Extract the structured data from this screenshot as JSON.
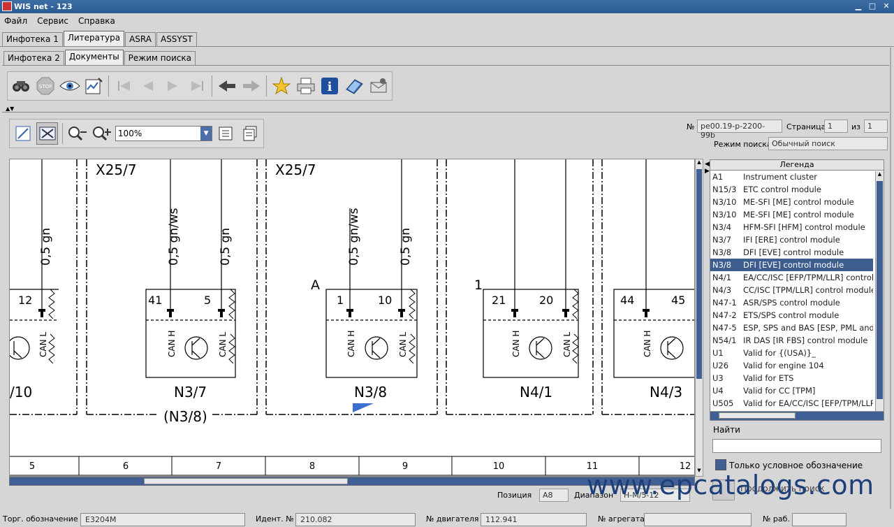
{
  "window": {
    "title": "WIS net - 123",
    "controls": [
      "▁",
      "□",
      "✕"
    ]
  },
  "menu": [
    "Файл",
    "Сервис",
    "Справка"
  ],
  "tabs_top": [
    {
      "label": "Инфотека 1",
      "active": false
    },
    {
      "label": "Литература",
      "active": true
    },
    {
      "label": "ASRA",
      "active": false
    },
    {
      "label": "ASSYST",
      "active": false
    }
  ],
  "tabs_second": [
    {
      "label": "Инфотека 2",
      "active": false
    },
    {
      "label": "Документы",
      "active": true
    },
    {
      "label": "Режим поиска",
      "active": false
    }
  ],
  "toolbar_icons": [
    "binoculars-icon",
    "stop-icon",
    "eye-icon",
    "chart-edit-icon",
    "first-page-icon",
    "prev-page-icon",
    "next-page-icon",
    "last-page-icon",
    "back-icon",
    "forward-icon",
    "star-icon",
    "print-icon",
    "info-icon",
    "book-icon",
    "mail-icon"
  ],
  "viewer": {
    "zoom": "100%",
    "doc_label": "№",
    "doc_number": "pe00.19-p-2200-99b",
    "page_label": "Страница",
    "page": "1",
    "of_label": "из",
    "total_pages": "1",
    "search_mode_label": "Режим поиска",
    "search_mode": "Обычный поиск"
  },
  "diagram": {
    "headers": [
      "X25/7",
      "X25/7"
    ],
    "wires": [
      "0,5 gn",
      "0,5 gn/ws",
      "0,5 gn",
      "0,5 gn/ws",
      "0,5 gn"
    ],
    "pins": [
      "12",
      "41",
      "5",
      "1",
      "10",
      "21",
      "20",
      "44",
      "45"
    ],
    "markers": [
      "A",
      "1"
    ],
    "can_labels": [
      "CAN L",
      "CAN H",
      "CAN L",
      "CAN H",
      "CAN L",
      "CAN H",
      "CAN L",
      "CAN H"
    ],
    "components": [
      "/10",
      "N3/7",
      "N3/8",
      "N4/1",
      "N4/3"
    ],
    "sub_label": "(N3/8)",
    "ruler": [
      "5",
      "6",
      "7",
      "8",
      "9",
      "10",
      "11",
      "12"
    ]
  },
  "legend": {
    "title": "Легенда",
    "items": [
      {
        "code": "A1",
        "text": "Instrument cluster"
      },
      {
        "code": "N15/3",
        "text": "ETC control module"
      },
      {
        "code": "N3/10",
        "text": "ME-SFI [ME] control module"
      },
      {
        "code": "N3/10",
        "text": "ME-SFI [ME] control module"
      },
      {
        "code": "N3/4",
        "text": "HFM-SFI [HFM] control module"
      },
      {
        "code": "N3/7",
        "text": "IFI [ERE] control module"
      },
      {
        "code": "N3/8",
        "text": "DFI [EVE] control module"
      },
      {
        "code": "N3/8",
        "text": "DFI [EVE] control module",
        "selected": true
      },
      {
        "code": "N4/1",
        "text": "EA/CC/ISC [EFP/TPM/LLR] control m"
      },
      {
        "code": "N4/3",
        "text": "CC/ISC [TPM/LLR] control module"
      },
      {
        "code": "N47-1",
        "text": "ASR/SPS control module"
      },
      {
        "code": "N47-2",
        "text": "ETS/SPS control module"
      },
      {
        "code": "N47-5",
        "text": "ESP, SPS and BAS [ESP, PML and"
      },
      {
        "code": "N54/1",
        "text": "IR DAS [IR FBS] control module"
      },
      {
        "code": "U1",
        "text": "Valid for {(USA)}_"
      },
      {
        "code": "U26",
        "text": "Valid for engine 104"
      },
      {
        "code": "U3",
        "text": "Valid for ETS"
      },
      {
        "code": "U4",
        "text": "Valid for CC [TPM]"
      },
      {
        "code": "U505",
        "text": "Valid for EA/CC/ISC [EFP/TPM/LLR"
      }
    ],
    "find_label": "Найти",
    "find_value": "",
    "only_symbol_label": "Только условное обозначение",
    "continue_label": "Продолжить поиск"
  },
  "position": {
    "pos_label": "Позиция",
    "pos_value": "A8",
    "range_label": "Диапазон",
    "range_value": "Н-М/5-12"
  },
  "status": [
    {
      "label": "Торг. обозначение",
      "value": "E3204M"
    },
    {
      "label": "Идент. №",
      "value": "210.082"
    },
    {
      "label": "№ двигателя",
      "value": "112.941"
    },
    {
      "label": "№ агрегата",
      "value": ""
    },
    {
      "label": "№ раб.",
      "value": ""
    }
  ],
  "watermark": "www.epcatalogs.com"
}
